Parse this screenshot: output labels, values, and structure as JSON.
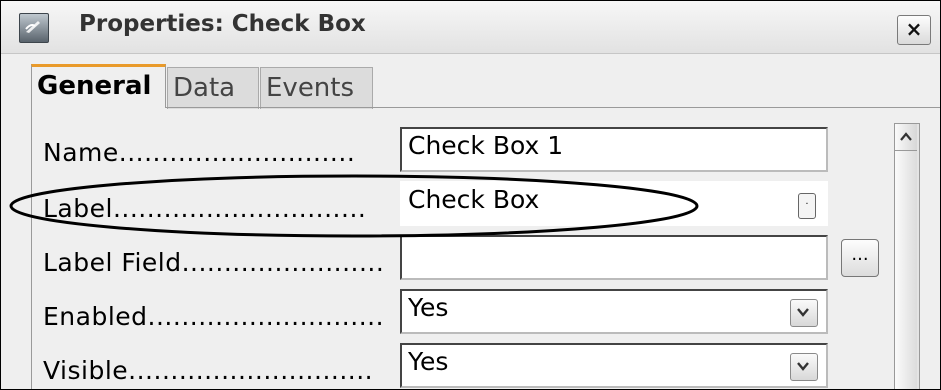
{
  "window": {
    "title": "Properties: Check Box",
    "close_label": "×"
  },
  "tabs": [
    {
      "label": "General",
      "active": true
    },
    {
      "label": "Data",
      "active": false
    },
    {
      "label": "Events",
      "active": false
    }
  ],
  "rows": [
    {
      "label": "Name............................",
      "value": "Check Box 1",
      "control": "text"
    },
    {
      "label": "Label..............................",
      "value": "Check Box",
      "control": "spin"
    },
    {
      "label": "Label Field........................",
      "value": "",
      "control": "text-with-button"
    },
    {
      "label": "Enabled............................",
      "value": "Yes",
      "control": "dropdown"
    },
    {
      "label": "Visible.............................",
      "value": "Yes",
      "control": "dropdown"
    }
  ],
  "label_field_button": "...",
  "spin_glyph": "·",
  "colors": {
    "active_tab_accent": "#e99a2a",
    "annotation_ellipse": "#000000"
  },
  "icons": [
    "form-properties-icon",
    "close-icon",
    "chevron-down-icon",
    "scroll-up-icon"
  ]
}
